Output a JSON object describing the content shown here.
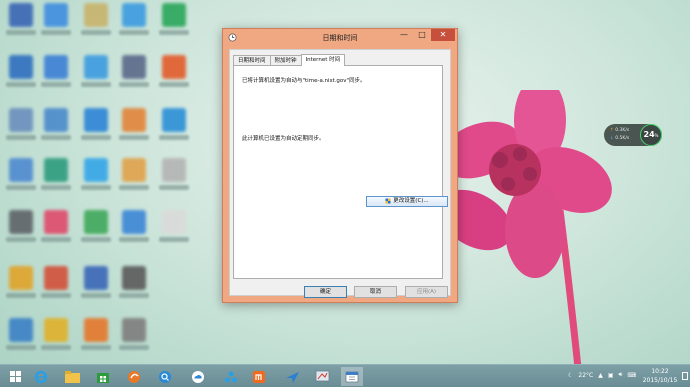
{
  "dialog": {
    "title": "日期和时间",
    "tabs": [
      {
        "label": "日期和时间"
      },
      {
        "label": "附加时钟"
      },
      {
        "label": "Internet 时间"
      }
    ],
    "sync_message": "已将计算机设置为自动与\"time-a.nist.gov\"同步。",
    "status_message": "此计算机已设置为自动定期同步。",
    "change_settings_label": "更改设置(C)...",
    "ok_label": "确定",
    "cancel_label": "取消",
    "apply_label": "应用(A)",
    "minimize_symbol": "—",
    "maximize_symbol": "□",
    "close_symbol": "✕"
  },
  "desktop": {
    "icons": [
      {
        "color": "#3a66b5"
      },
      {
        "color": "#3f8de0"
      },
      {
        "color": "#c8b36a"
      },
      {
        "color": "#3c9ce0"
      },
      {
        "color": "#2aa65a"
      },
      {
        "color": "#2f6fc0"
      },
      {
        "color": "#3b7fd6"
      },
      {
        "color": "#3c9ce0"
      },
      {
        "color": "#5a6a8a"
      },
      {
        "color": "#e25b2a"
      },
      {
        "color": "#6a8fbd"
      },
      {
        "color": "#4a8acb"
      },
      {
        "color": "#2b84d6"
      },
      {
        "color": "#e2843a"
      },
      {
        "color": "#2b8fd6"
      },
      {
        "color": "#4f8ad0"
      },
      {
        "color": "#2e9c7e"
      },
      {
        "color": "#34a6e8"
      },
      {
        "color": "#e0a24a"
      },
      {
        "color": "#b4b4b4"
      },
      {
        "color": "#5e6368"
      },
      {
        "color": "#e04a6a"
      },
      {
        "color": "#3fa85a"
      },
      {
        "color": "#3c86d6"
      },
      {
        "color": "#dadada"
      },
      {
        "color": "#e0a42a"
      },
      {
        "color": "#d2503a"
      },
      {
        "color": "#3a67b8"
      },
      {
        "color": "#5a5a5a"
      },
      {
        "color": "#3c80c6"
      },
      {
        "color": "#e0b12a"
      },
      {
        "color": "#e6772a"
      },
      {
        "color": "#7d7d7d"
      }
    ],
    "doc_labels": [
      "",
      ""
    ]
  },
  "netwidget": {
    "upload": "0.3K/s",
    "download": "0.5K/s",
    "value": "24",
    "unit": "%",
    "up_arrow": "↑",
    "down_arrow": "↓"
  },
  "taskbar": {
    "temperature": "22°C",
    "time": "10:22",
    "date": "2015/10/15"
  }
}
